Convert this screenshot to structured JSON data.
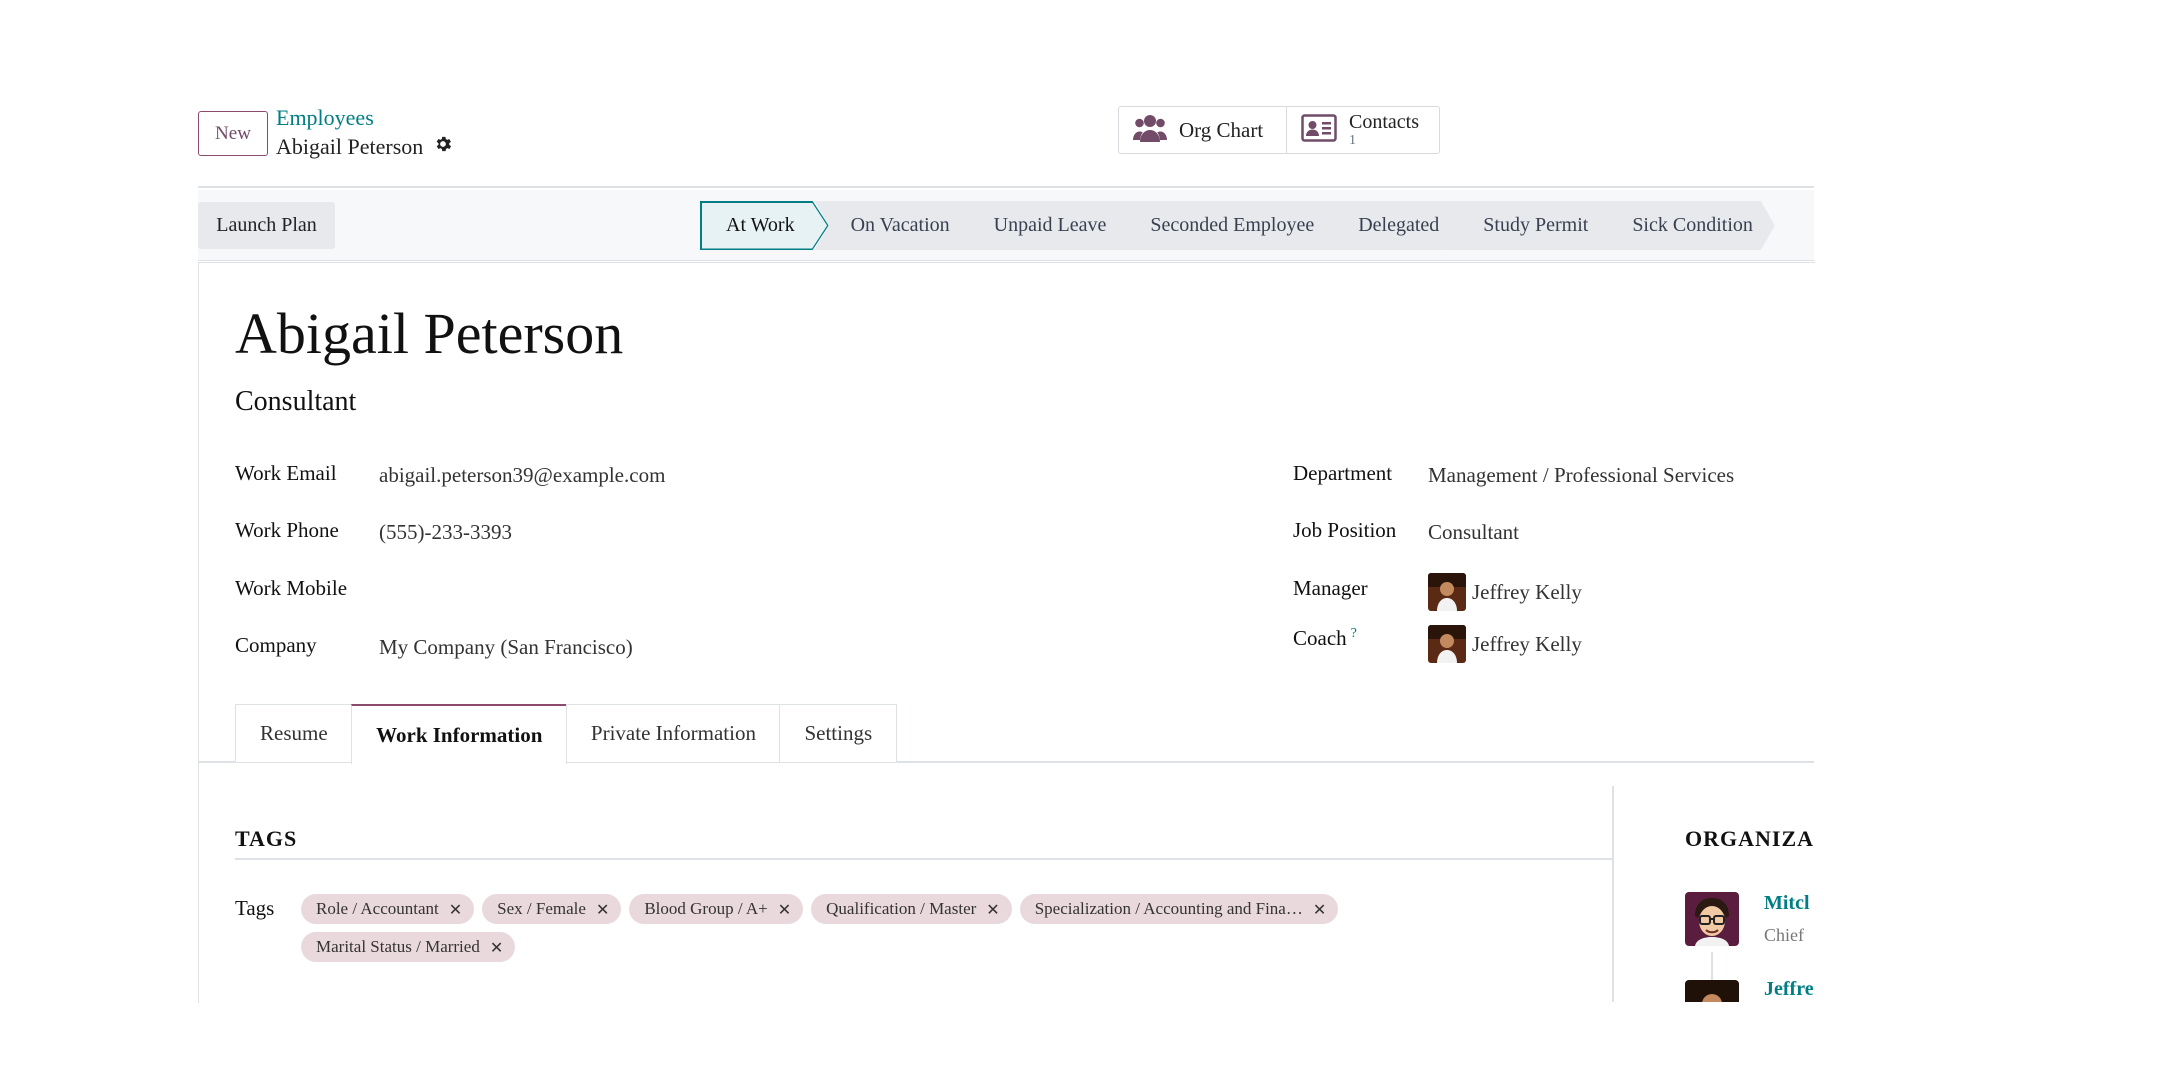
{
  "control_panel": {
    "new_label": "New",
    "breadcrumb_parent": "Employees",
    "breadcrumb_current": "Abigail Peterson",
    "smart_buttons": {
      "org_chart_label": "Org Chart",
      "contacts_label": "Contacts",
      "contacts_count": "1"
    }
  },
  "statusbar": {
    "launch_plan_label": "Launch Plan",
    "stages": [
      "At Work",
      "On Vacation",
      "Unpaid Leave",
      "Seconded Employee",
      "Delegated",
      "Study Permit",
      "Sick Condition"
    ],
    "active_stage": "At Work"
  },
  "employee": {
    "name": "Abigail Peterson",
    "job_title": "Consultant"
  },
  "fields_left": {
    "work_email_label": "Work Email",
    "work_email": "abigail.peterson39@example.com",
    "work_phone_label": "Work Phone",
    "work_phone": "(555)-233-3393",
    "work_mobile_label": "Work Mobile",
    "work_mobile": "",
    "company_label": "Company",
    "company": "My Company (San Francisco)"
  },
  "fields_right": {
    "department_label": "Department",
    "department": "Management / Professional Services",
    "job_position_label": "Job Position",
    "job_position": "Consultant",
    "manager_label": "Manager",
    "manager": "Jeffrey Kelly",
    "coach_label": "Coach",
    "coach_help": "?",
    "coach": "Jeffrey Kelly"
  },
  "tabs": {
    "resume": "Resume",
    "work_information": "Work Information",
    "private_information": "Private Information",
    "settings": "Settings",
    "active": "Work Information"
  },
  "work_info": {
    "tags_section_title": "TAGS",
    "tags_label": "Tags",
    "tags": [
      "Role / Accountant",
      "Sex / Female",
      "Blood Group / A+",
      "Qualification / Master",
      "Specialization / Accounting and Fina…",
      "Marital Status / Married"
    ],
    "tag_remove_glyph": "✕",
    "org_title": "ORGANIZA",
    "org_people": [
      {
        "name": "Mitcl",
        "title": "Chief"
      },
      {
        "name": "Jeffre",
        "title": ""
      }
    ]
  },
  "colors": {
    "brand": "#714b67",
    "accent": "#017e84",
    "tag_bg": "#ead9dc",
    "statusbar_bg": "#f7f8fa"
  },
  "icons": {
    "settings": "gear-icon",
    "org_chart": "users-icon",
    "contacts": "address-card-icon",
    "tag_remove": "close-icon"
  }
}
